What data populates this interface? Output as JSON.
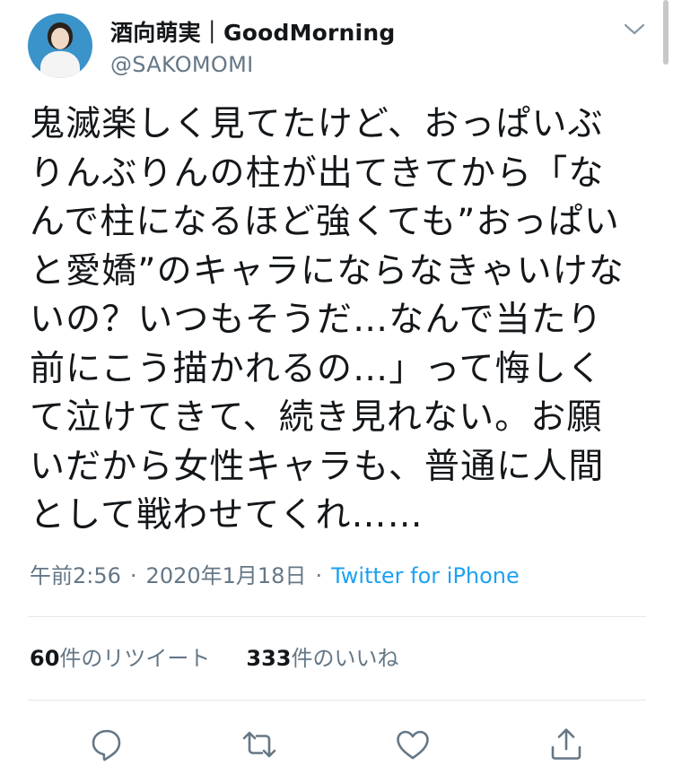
{
  "user": {
    "display_name": "酒向萌実｜GoodMorning",
    "handle": "@SAKOMOMI"
  },
  "tweet": {
    "lines": [
      "鬼滅楽しく見てたけど、おっぱいぶ",
      "りんぶりんの柱が出てきてから「な",
      "んで柱になるほど強くても”おっぱい",
      "と愛嬌”のキャラにならなきゃいけな",
      "いの？いつもそうだ…なんで当たり",
      "前にこう描かれるの…」って悔しく",
      "て泣けてきて、続き見れない。お願",
      "いだから女性キャラも、普通に人間",
      "として戦わせてくれ……"
    ]
  },
  "meta": {
    "time": "午前2:56",
    "separator": "·",
    "date": "2020年1月18日",
    "source": "Twitter for iPhone"
  },
  "stats": {
    "retweets_count": "60",
    "retweets_label": "件のリツイート",
    "likes_count": "333",
    "likes_label": "件のいいね"
  },
  "icons": {
    "menu": "chevron-down-icon",
    "reply": "reply-icon",
    "retweet": "retweet-icon",
    "like": "heart-icon",
    "share": "share-icon"
  },
  "colors": {
    "text": "#14171a",
    "secondary": "#657786",
    "link": "#1da1f2",
    "divider": "#e1e8ed"
  }
}
